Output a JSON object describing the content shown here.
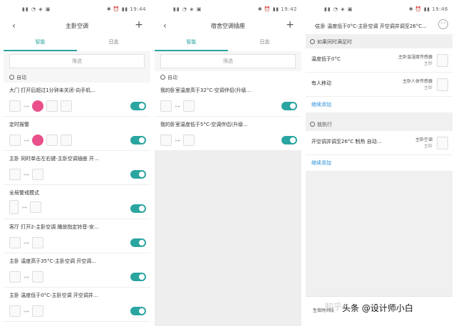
{
  "screens": [
    {
      "status_time": "19:44",
      "title": "主卧空调",
      "tabs": [
        "智能",
        "日志"
      ],
      "filter": "筛选",
      "section": "自动",
      "rules": [
        "大门 打开后超过1分钟未关闭-向手机...",
        "定时报警",
        "主卧 同时单击左右键-主卧空调插座 开...",
        "全局警戒模式",
        "客厅 打开2-主卧空调 播放指定铃音-安...",
        "主卧 温度高于35°C-主卧空调 开空调...",
        "主卧 温度低于0°C-主卧空调 开空调并..."
      ]
    },
    {
      "status_time": "19:42",
      "title": "宿舍空调插座",
      "tabs": [
        "智能",
        "日志"
      ],
      "filter": "筛选",
      "section": "自动",
      "rules": [
        "我的卧室温度高于32°C-空调伴侣(升级...",
        "我的卧室温度低于5°C-空调伴侣(升级..."
      ]
    },
    {
      "status_time": "19:46",
      "title": "主卧 温度低于0°C-主卧空调 开空调并调至26°C...",
      "more": "···",
      "if_section": "如果同时满足时",
      "conditions": [
        {
          "name": "温度低于0°C",
          "device": "主卧温湿度传感器",
          "room": "主卧"
        },
        {
          "name": "有人移动",
          "device": "主卧人体传感器",
          "room": "主卧"
        }
      ],
      "add": "继续添加",
      "then_section": "就执行",
      "action": {
        "name": "开空调并调至26°C 制热 自动...",
        "device": "主卧空调",
        "room": "主卧"
      },
      "add2": "继续添加",
      "effect": "生效时间段"
    }
  ],
  "watermark": "头条 @设计师小白"
}
